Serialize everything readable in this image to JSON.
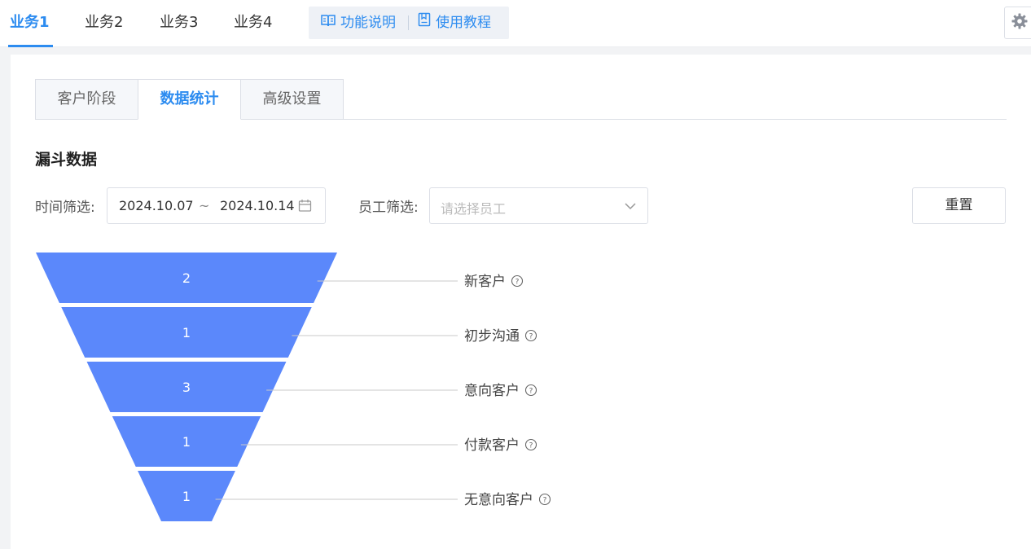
{
  "top_tabs": [
    {
      "label": "业务1",
      "active": true
    },
    {
      "label": "业务2",
      "active": false
    },
    {
      "label": "业务3",
      "active": false
    },
    {
      "label": "业务4",
      "active": false
    }
  ],
  "help_links": {
    "feature_desc": "功能说明",
    "tutorial": "使用教程"
  },
  "sub_tabs": [
    {
      "label": "客户阶段",
      "active": false
    },
    {
      "label": "数据统计",
      "active": true
    },
    {
      "label": "高级设置",
      "active": false
    }
  ],
  "section_title": "漏斗数据",
  "filters": {
    "time_label": "时间筛选:",
    "date_start": "2024.10.07",
    "date_sep": "~",
    "date_end": "2024.10.14",
    "staff_label": "员工筛选:",
    "staff_placeholder": "请选择员工",
    "reset_label": "重置"
  },
  "colors": {
    "accent": "#2d8cf0",
    "funnel_fill": "#5b88fb"
  },
  "icons": {
    "feature_desc": "book-open-icon",
    "tutorial": "bookmark-icon",
    "settings": "gear-icon",
    "calendar": "calendar-icon",
    "dropdown": "chevron-down-icon",
    "help": "question-circle-icon"
  },
  "chart_data": {
    "type": "funnel",
    "categories": [
      "新客户",
      "初步沟通",
      "意向客户",
      "付款客户",
      "无意向客户"
    ],
    "values": [
      2,
      1,
      3,
      1,
      1
    ]
  }
}
